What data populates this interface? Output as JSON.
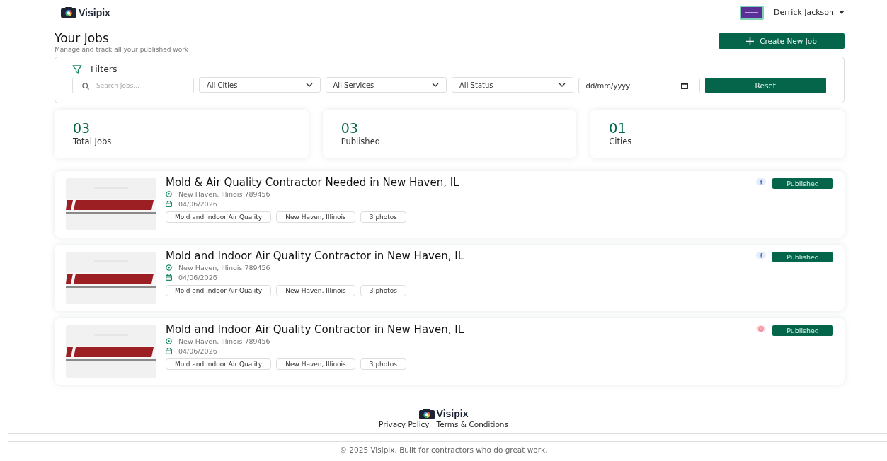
{
  "header": {
    "brand": "Visipix",
    "user": {
      "name": "Derrick Jackson"
    }
  },
  "page": {
    "title": "Your Jobs",
    "subtitle": "Manage and track all your published work",
    "create_button": "Create New Job"
  },
  "filters": {
    "title": "Filters",
    "search": {
      "placeholder": "Search Jobs..."
    },
    "selects": [
      "All Cities",
      "All Services",
      "All Status"
    ],
    "date": {
      "placeholder": "dd/mm/yyyy"
    },
    "reset_button": "Reset"
  },
  "stats": [
    {
      "value": "03",
      "label": "Total Jobs"
    },
    {
      "value": "03",
      "label": "Published"
    },
    {
      "value": "01",
      "label": "Cities"
    }
  ],
  "jobs": [
    {
      "title": "Mold & Air Quality Contractor Needed in New Haven, IL",
      "location": "New Haven, Illinois 789456",
      "date": "04/06/2026",
      "tags": [
        "Mold and Indoor Air Quality",
        "New Haven, Illinois",
        "3 photos"
      ],
      "platform_icon": {
        "kind": "facebook"
      },
      "status": "Published"
    },
    {
      "title": "Mold and Indoor Air Quality Contractor in New Haven, IL",
      "location": "New Haven, Illinois 789456",
      "date": "04/06/2026",
      "tags": [
        "Mold and Indoor Air Quality",
        "New Haven, Illinois",
        "3 photos"
      ],
      "platform_icon": {
        "kind": "facebook"
      },
      "status": "Published"
    },
    {
      "title": "Mold and Indoor Air Quality Contractor in New Haven, IL",
      "location": "New Haven, Illinois 789456",
      "date": "04/06/2026",
      "tags": [
        "Mold and Indoor Air Quality",
        "New Haven, Illinois",
        "3 photos"
      ],
      "platform_icon": {
        "kind": "instagram"
      },
      "status": "Published"
    }
  ],
  "footer": {
    "brand": "Visipix",
    "links": [
      "Privacy Policy",
      "Terms & Conditions"
    ],
    "copyright": "© 2025 Visipix. Built for contractors who do great work."
  }
}
